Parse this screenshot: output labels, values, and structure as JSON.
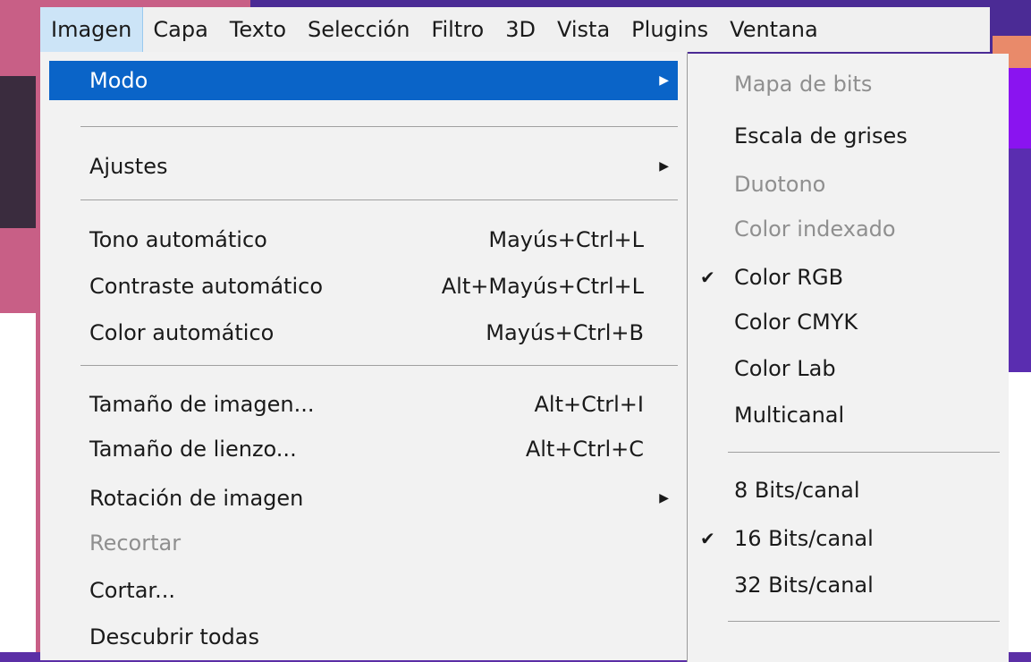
{
  "menubar": [
    "Imagen",
    "Capa",
    "Texto",
    "Selección",
    "Filtro",
    "3D",
    "Vista",
    "Plugins",
    "Ventana"
  ],
  "menu": {
    "items": [
      {
        "label": "Modo",
        "shortcut": "",
        "submenu": true
      },
      {
        "label": "Ajustes",
        "shortcut": "",
        "submenu": true
      },
      {
        "label": "Tono automático",
        "shortcut": "Mayús+Ctrl+L"
      },
      {
        "label": "Contraste automático",
        "shortcut": "Alt+Mayús+Ctrl+L"
      },
      {
        "label": "Color automático",
        "shortcut": "Mayús+Ctrl+B"
      },
      {
        "label": "Tamaño de imagen...",
        "shortcut": "Alt+Ctrl+I"
      },
      {
        "label": "Tamaño de lienzo...",
        "shortcut": "Alt+Ctrl+C"
      },
      {
        "label": "Rotación de imagen",
        "shortcut": "",
        "submenu": true
      },
      {
        "label": "Recortar",
        "shortcut": "",
        "disabled": true
      },
      {
        "label": "Cortar...",
        "shortcut": ""
      },
      {
        "label": "Descubrir todas",
        "shortcut": ""
      }
    ]
  },
  "submenu": {
    "items": [
      {
        "label": "Mapa de bits",
        "disabled": true
      },
      {
        "label": "Escala de grises"
      },
      {
        "label": "Duotono",
        "disabled": true
      },
      {
        "label": "Color indexado",
        "disabled": true
      },
      {
        "label": "Color RGB",
        "checked": true
      },
      {
        "label": "Color CMYK"
      },
      {
        "label": "Color Lab"
      },
      {
        "label": "Multicanal"
      },
      {
        "label": "8 Bits/canal"
      },
      {
        "label": "16 Bits/canal",
        "checked": true
      },
      {
        "label": "32 Bits/canal"
      }
    ],
    "check_glyph": "✔"
  },
  "icons": {
    "submenu_arrow": "chevron-right-icon",
    "check": "check-icon"
  },
  "colors": {
    "selection": "#0a64c8",
    "menu_bg": "#f2f2f2",
    "disabled_text": "#8f8f8f"
  }
}
